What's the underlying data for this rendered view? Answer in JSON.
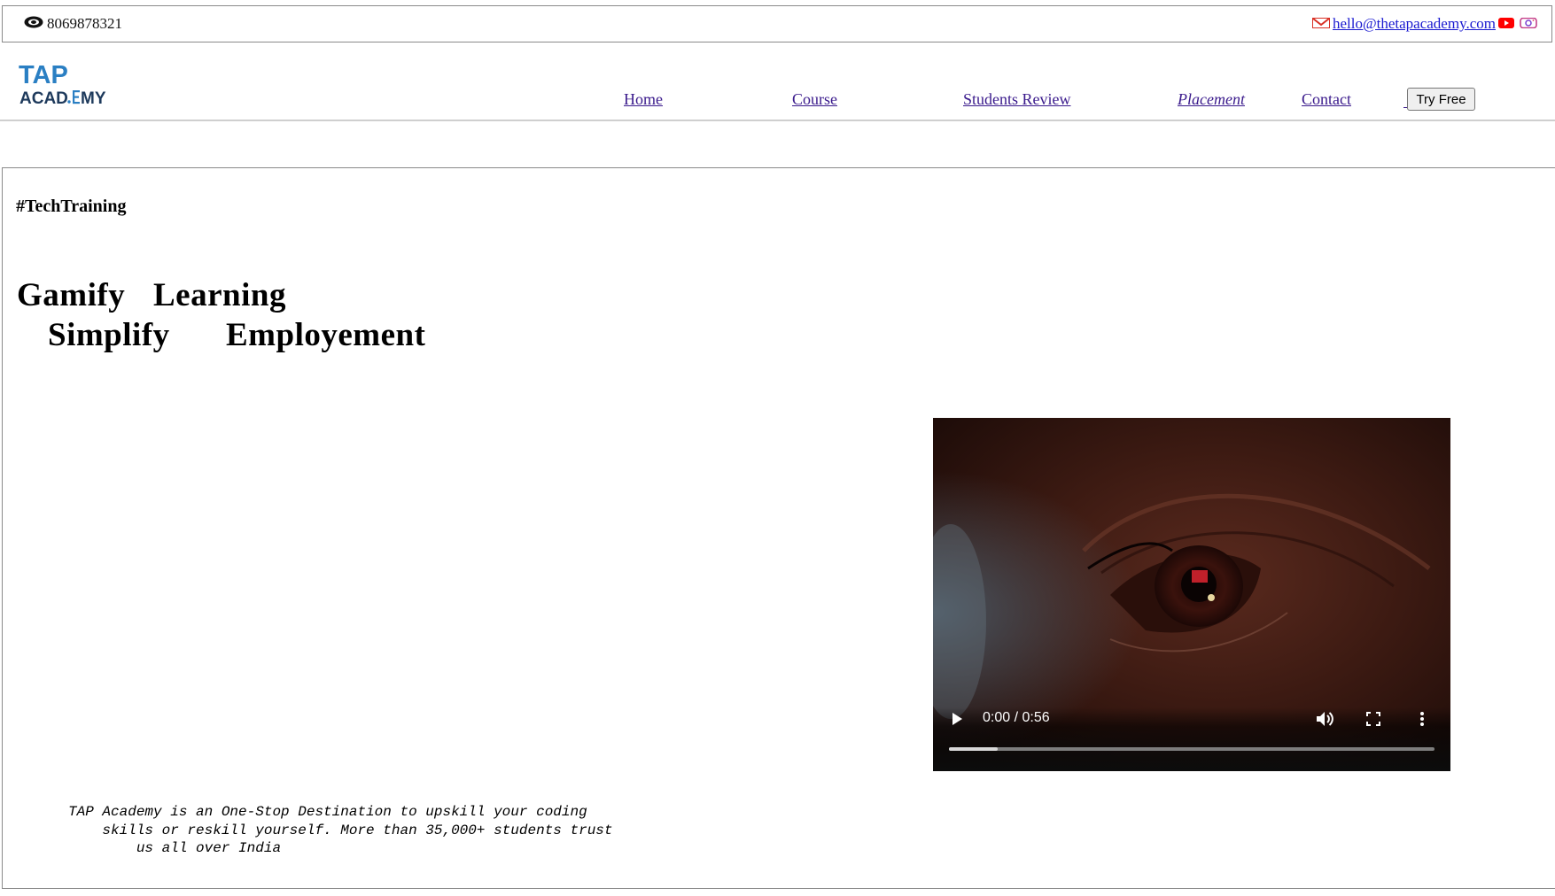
{
  "topbar": {
    "phone": "8069878321",
    "email": " hello@thetapacademy.com ",
    "spacer_link": " "
  },
  "header": {
    "logo": {
      "line1": "TAP",
      "line2_prefix": "ACAD",
      "line2_suffix": "MY",
      "accent_color": "#2a7fc3",
      "text_color": "#1e3a5c"
    },
    "nav": [
      {
        "label": " Home"
      },
      {
        "label": "Course"
      },
      {
        "label": "Students Review"
      },
      {
        "label": "Placement"
      },
      {
        "label": "Contact"
      }
    ],
    "try_free": "Try Free"
  },
  "hero": {
    "hashtag": "#TechTraining",
    "headline_line1_a": "Gamify",
    "headline_line1_b": "Learning",
    "headline_line2_a": "Simplify",
    "headline_line2_b": "Employement",
    "about_lines": [
      "TAP Academy is an One-Stop Destination to upskill your coding",
      "    skills or reskill yourself. More than 35,000+ students trust",
      "        us all over India"
    ]
  },
  "video": {
    "time": "0:00 / 0:56",
    "progress": 0.1,
    "icons": [
      "play-icon",
      "volume-icon",
      "fullscreen-icon",
      "more-options-icon"
    ]
  },
  "colors": {
    "link": "#1a1ad0",
    "visited_link": "#3a1a8c",
    "gmail_red": "#d93025",
    "youtube_red": "#ff0000",
    "instagram_purple": "#c13584"
  }
}
